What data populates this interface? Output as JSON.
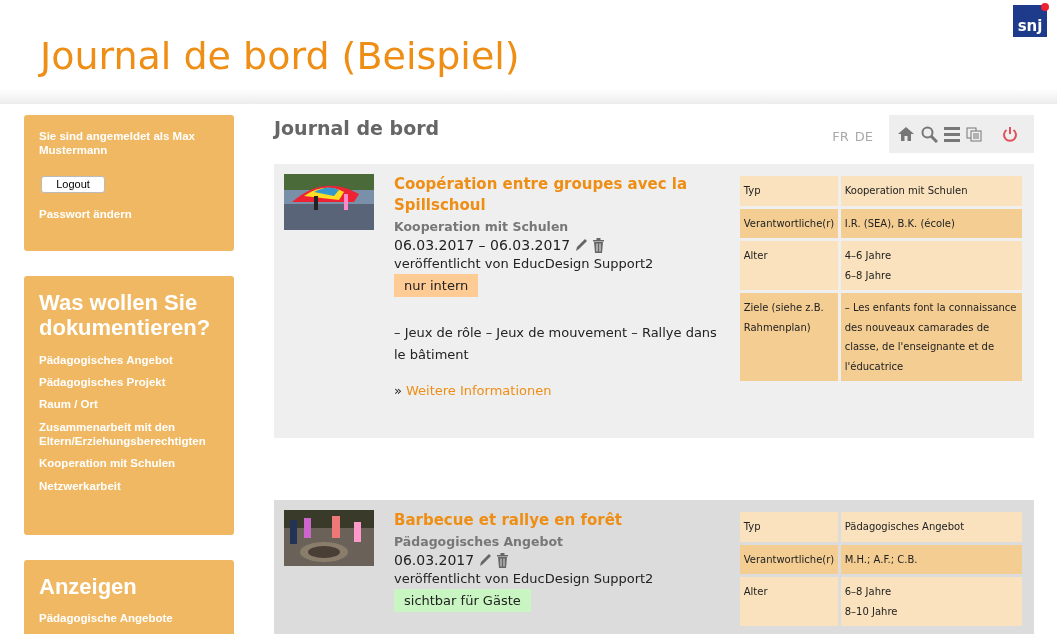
{
  "header": {
    "title": "Journal de bord (Beispiel)",
    "logo": "snj"
  },
  "sidebar": {
    "login": {
      "text": "Sie sind angemeldet als Max Mustermann",
      "logout": "Logout",
      "password": "Passwort ändern"
    },
    "sections": [
      {
        "heading": "Was wollen Sie dokumentieren?",
        "items": [
          "Pädagogisches Angebot",
          "Pädagogisches Projekt",
          "Raum / Ort",
          "Zusammenarbeit mit den Eltern/Erziehungsberechtigten",
          "Kooperation mit Schulen",
          "Netzwerkarbeit"
        ]
      },
      {
        "heading": "Anzeigen",
        "items": [
          "Pädagogische Angebote"
        ]
      }
    ]
  },
  "main": {
    "title": "Journal de bord",
    "languages": [
      "FR",
      "DE"
    ],
    "entries": [
      {
        "title": "Coopération entre groupes avec la Spillschoul",
        "category": "Kooperation mit Schulen",
        "date": "06.03.2017 – 06.03.2017",
        "author": "veröffentlicht von EducDesign Support2",
        "badge": {
          "kind": "internal",
          "text": "nur intern"
        },
        "description": "– Jeux de rôle – Jeux de mouvement – Rallye dans le bâtiment",
        "more_prefix": "»",
        "more": "Weitere Informationen",
        "details": [
          {
            "label": "Typ",
            "values": [
              "Kooperation mit Schulen"
            ]
          },
          {
            "label": "Verantwortliche(r)",
            "values": [
              "I.R. (SEA), B.K. (école)"
            ]
          },
          {
            "label": "Alter",
            "values": [
              "4–6 Jahre",
              "6–8 Jahre"
            ]
          },
          {
            "label": "Ziele (siehe z.B. Rahmenplan)",
            "values": [
              "– Les enfants font la connaissance des nouveaux camarades de classe, de l'enseignante et de l'éducatrice"
            ]
          }
        ]
      },
      {
        "title": "Barbecue et rallye en forêt",
        "category": "Pädagogisches Angebot",
        "date": "06.03.2017",
        "author": "veröffentlicht von EducDesign Support2",
        "badge": {
          "kind": "public",
          "text": "sichtbar für Gäste"
        },
        "details": [
          {
            "label": "Typ",
            "values": [
              "Pädagogisches Angebot"
            ]
          },
          {
            "label": "Verantwortliche(r)",
            "values": [
              "M.H.; A.F.; C.B."
            ]
          },
          {
            "label": "Alter",
            "values": [
              "6–8 Jahre",
              "8–10 Jahre"
            ]
          }
        ]
      }
    ]
  }
}
